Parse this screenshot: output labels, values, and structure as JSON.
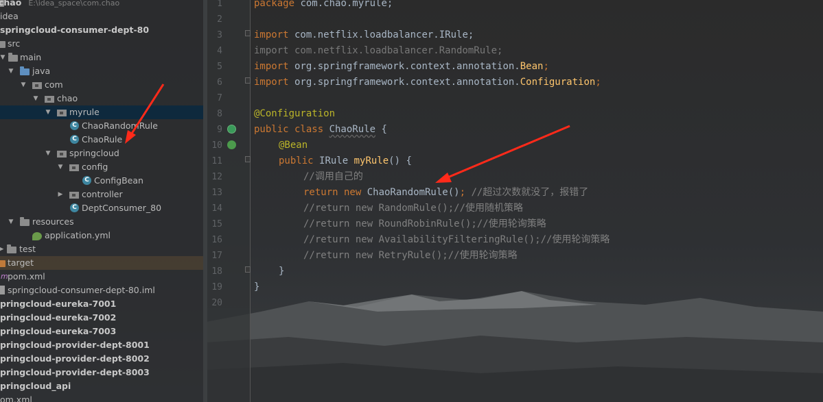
{
  "project_tree": {
    "items": [
      {
        "label": "chao",
        "path": "E:\\idea_space\\com.chao",
        "bold": true
      },
      {
        "label": "idea"
      },
      {
        "label": "springcloud-consumer-dept-80",
        "bold": true
      },
      {
        "label": "src"
      },
      {
        "label": "main"
      },
      {
        "label": "java"
      },
      {
        "label": "com"
      },
      {
        "label": "chao"
      },
      {
        "label": "myrule"
      },
      {
        "label": "ChaoRandomRule"
      },
      {
        "label": "ChaoRule"
      },
      {
        "label": "springcloud"
      },
      {
        "label": "config"
      },
      {
        "label": "ConfigBean"
      },
      {
        "label": "controller"
      },
      {
        "label": "DeptConsumer_80"
      },
      {
        "label": "resources"
      },
      {
        "label": "application.yml"
      },
      {
        "label": "test"
      },
      {
        "label": "target"
      },
      {
        "label": "pom.xml"
      },
      {
        "label": "springcloud-consumer-dept-80.iml"
      },
      {
        "label": "pringcloud-eureka-7001",
        "bold": true
      },
      {
        "label": "pringcloud-eureka-7002",
        "bold": true
      },
      {
        "label": "pringcloud-eureka-7003",
        "bold": true
      },
      {
        "label": "pringcloud-provider-dept-8001",
        "bold": true
      },
      {
        "label": "pringcloud-provider-dept-8002",
        "bold": true
      },
      {
        "label": "pringcloud-provider-dept-8003",
        "bold": true
      },
      {
        "label": "pringcloud_api",
        "bold": true
      },
      {
        "label": "om.xml"
      }
    ]
  },
  "editor": {
    "line_numbers": [
      "1",
      "2",
      "3",
      "4",
      "5",
      "6",
      "7",
      "8",
      "9",
      "10",
      "11",
      "12",
      "13",
      "14",
      "15",
      "16",
      "17",
      "18",
      "19",
      "20"
    ],
    "lines": {
      "l1_kw": "package",
      "l1_rest": " com.chao.myrule;",
      "l3_kw": "import",
      "l3_rest": " com.netflix.loadbalancer.IRule;",
      "l4": "import com.netflix.loadbalancer.RandomRule;",
      "l5_kw": "import",
      "l5_rest": " org.springframework.context.annotation.",
      "l5_ann": "Bean",
      "l5_end": ";",
      "l6_kw": "import",
      "l6_rest": " org.springframework.context.annotation.",
      "l6_ann": "Configuration",
      "l6_end": ";",
      "l8_ann": "@Configuration",
      "l9_kw": "public class ",
      "l9_cls": "ChaoRule",
      "l9_end": " {",
      "l10_ann": "@Bean",
      "l11_kw": "public ",
      "l11_type": "IRule ",
      "l11_fn": "myRule",
      "l11_end": "() {",
      "l12_cm": "//调用自己的",
      "l13_kw": "return new ",
      "l13_rest": "ChaoRandomRule()",
      "l13_semi": ";",
      "l13_cm": " //超过次数就没了，报错了",
      "l14_cm": "//return new RandomRule();//使用随机策略",
      "l15_cm": "//return new RoundRobinRule();//使用轮询策略",
      "l16_cm": "//return new AvailabilityFilteringRule();//使用轮询策略",
      "l17_cm": "//return new RetryRule();//使用轮询策略",
      "l18": "}",
      "l19": "}"
    }
  },
  "colors": {
    "keyword": "#cc7832",
    "annotation": "#bbb529",
    "method": "#ffc66d",
    "comment": "#808080",
    "text": "#a9b7c6",
    "arrow": "#ff2a1a"
  }
}
